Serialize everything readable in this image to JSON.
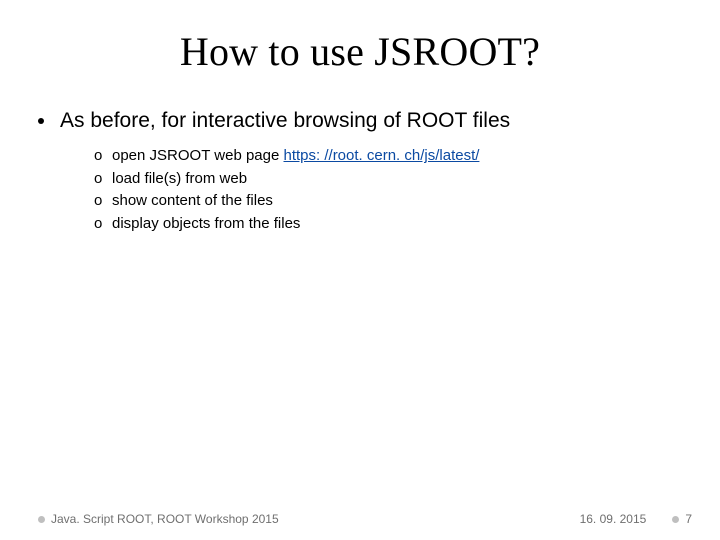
{
  "title": "How to use JSROOT?",
  "main_bullet": "As before, for interactive browsing of ROOT files",
  "sub_marker": "o",
  "sub_items": [
    {
      "prefix": "open JSROOT web page ",
      "link": "https: //root. cern. ch/js/latest/"
    },
    {
      "prefix": "load file(s) from web",
      "link": ""
    },
    {
      "prefix": "show content of the files",
      "link": ""
    },
    {
      "prefix": "display objects from the files",
      "link": ""
    }
  ],
  "footer": {
    "left": "Java. Script ROOT, ROOT Workshop 2015",
    "date": "16. 09. 2015",
    "page": "7"
  }
}
